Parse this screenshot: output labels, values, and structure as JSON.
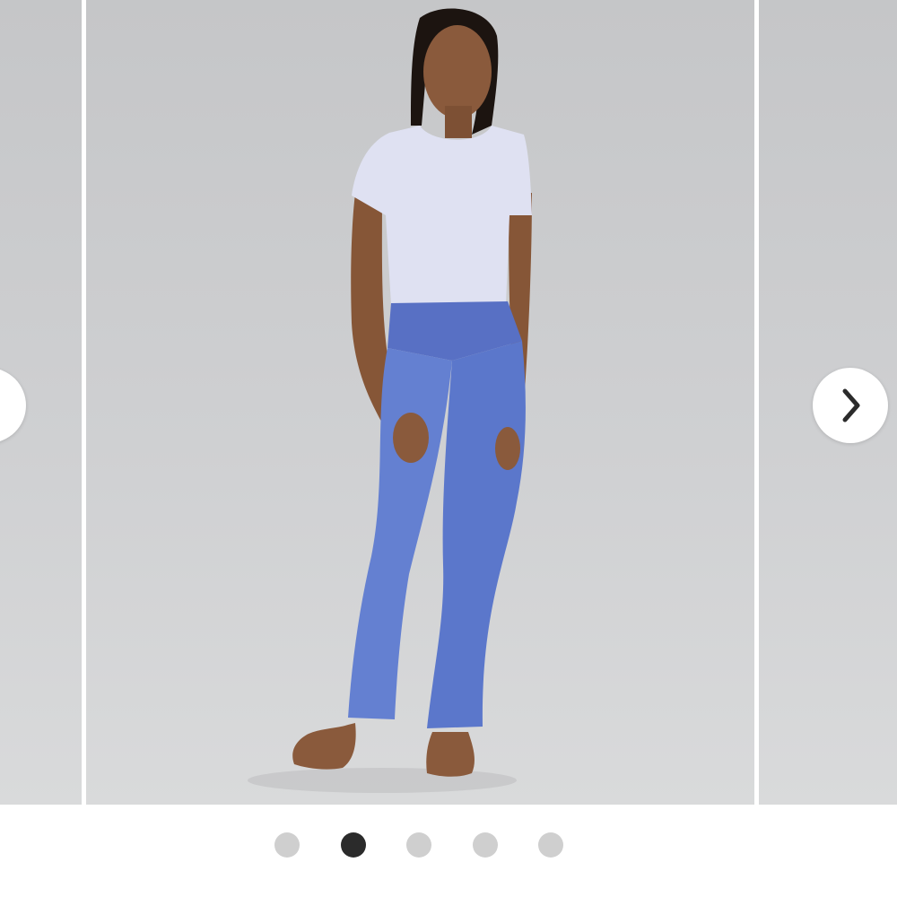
{
  "carousel": {
    "slide_count": 5,
    "active_index": 1,
    "background_color": "#cbcccd",
    "active_dot_color": "#2b2b2b",
    "inactive_dot_color": "#cfcfcf",
    "prev_icon": "chevron-left-icon",
    "next_icon": "chevron-right-icon"
  }
}
